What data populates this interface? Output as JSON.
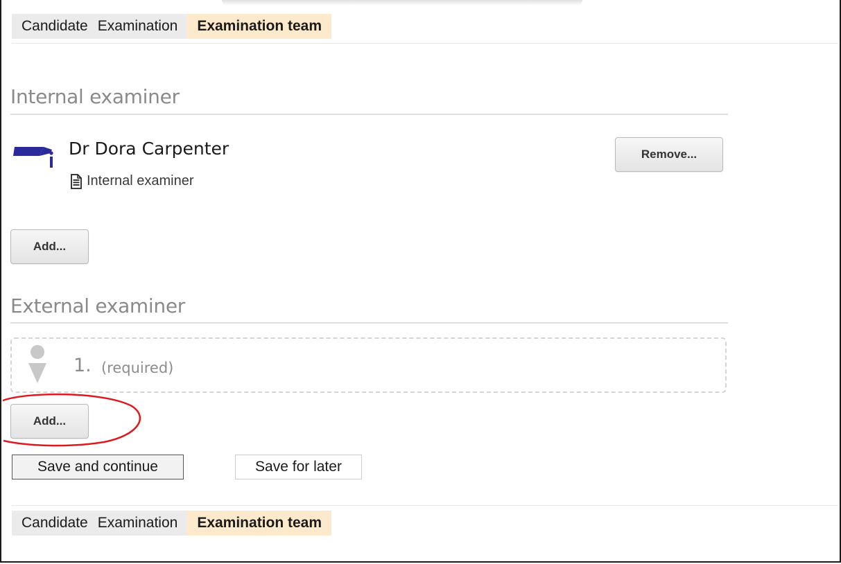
{
  "tabs": [
    "Candidate",
    "Examination",
    "Examination team"
  ],
  "internal": {
    "title": "Internal examiner",
    "person_name": "Dr Dora Carpenter",
    "person_role": "Internal examiner",
    "remove_label": "Remove...",
    "add_label": "Add..."
  },
  "external": {
    "title": "External examiner",
    "slot_number": "1.",
    "slot_status": "(required)",
    "add_label": "Add..."
  },
  "actions": {
    "save_continue": "Save and continue",
    "save_later": "Save for later"
  },
  "colors": {
    "active_tab_bg": "#fde9cc",
    "tab_bg": "#ebebeb",
    "annotation_circle": "#e0181e",
    "mortarboard_icon": "#2b2a9a"
  }
}
